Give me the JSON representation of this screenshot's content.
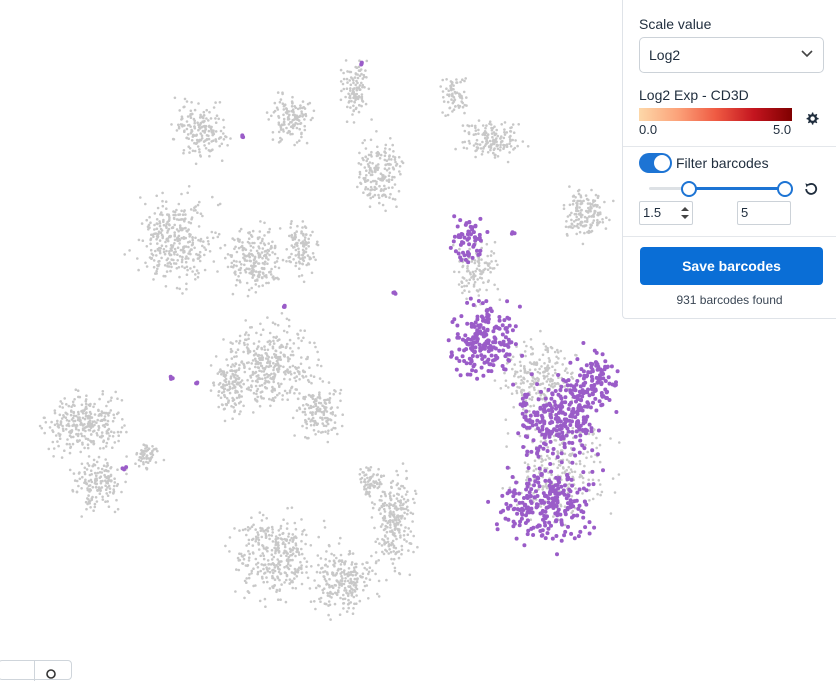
{
  "panel": {
    "scale_label": "Scale value",
    "scale_selected": "Log2",
    "legend_title": "Log2 Exp - CD3D",
    "legend_min": "0.0",
    "legend_max": "5.0",
    "filter_label": "Filter barcodes",
    "filter_enabled": true,
    "filter_min": 1.5,
    "filter_max": 5,
    "range_min": "1.5",
    "range_max": "5",
    "save_label": "Save barcodes",
    "found_text": "931 barcodes found"
  },
  "colors": {
    "background_points": "#c8c8c8",
    "highlight_points": "#9a5cc8",
    "accent": "#0a6ed6",
    "colorbar_low": "#fdd8a9",
    "colorbar_high": "#7f0000"
  },
  "icons": {
    "select": "chevron-down-icon",
    "legend_settings": "gear-icon",
    "reset": "reset-icon"
  }
}
